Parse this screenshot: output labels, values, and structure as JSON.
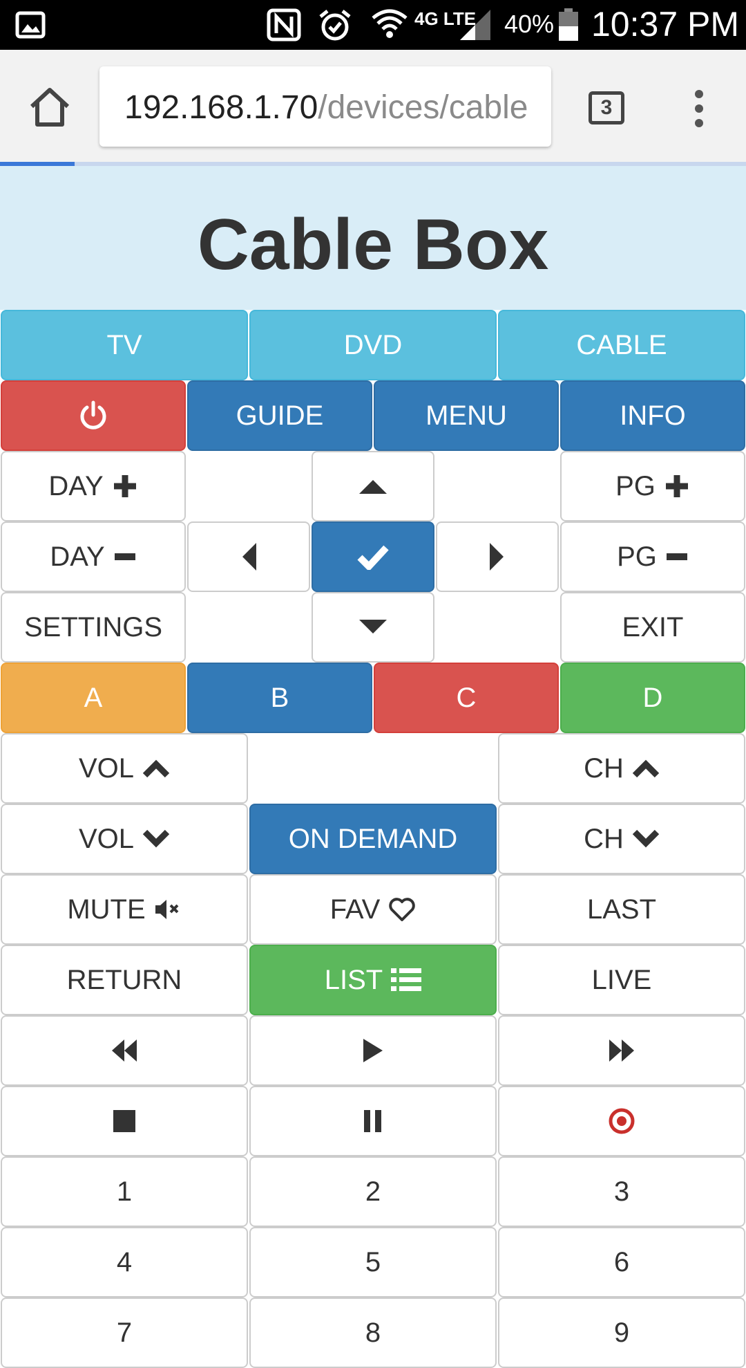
{
  "status_bar": {
    "battery_percent": "40%",
    "time": "10:37 PM",
    "network": "4G LTE",
    "icons": [
      "gallery-icon",
      "nfc-icon",
      "alarm-icon",
      "wifi-icon",
      "signal-icon",
      "battery-icon"
    ]
  },
  "browser": {
    "url_host": "192.168.1.70",
    "url_path": "/devices/cable",
    "tab_count": "3",
    "load_progress": 0.1
  },
  "page": {
    "title": "Cable Box"
  },
  "devices": [
    "TV",
    "DVD",
    "CABLE"
  ],
  "nav": {
    "guide": "GUIDE",
    "menu": "MENU",
    "info": "INFO"
  },
  "controls": {
    "day": "DAY",
    "pg": "PG",
    "settings": "SETTINGS",
    "exit": "EXIT"
  },
  "color_buttons": [
    "A",
    "B",
    "C",
    "D"
  ],
  "volume": {
    "vol": "VOL",
    "ch": "CH",
    "on_demand": "ON DEMAND"
  },
  "misc": {
    "mute": "MUTE",
    "fav": "FAV",
    "last": "LAST",
    "return": "RETURN",
    "list": "LIST",
    "live": "LIVE"
  },
  "numbers": [
    "1",
    "2",
    "3",
    "4",
    "5",
    "6",
    "7",
    "8",
    "9"
  ],
  "colors": {
    "info": "#5bc0de",
    "primary": "#337ab7",
    "danger": "#d9534f",
    "warning": "#f0ad4e",
    "success": "#5cb85c",
    "header_bg": "#d9edf7",
    "record": "#c9302c"
  }
}
